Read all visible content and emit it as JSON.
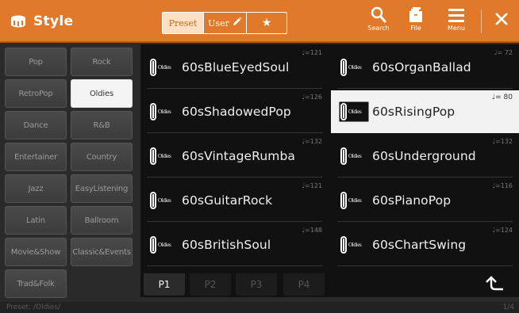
{
  "header": {
    "title": "Style",
    "tabs": {
      "preset": "Preset",
      "user": "User",
      "favorite": "★"
    },
    "buttons": {
      "search": "Search",
      "file": "File",
      "menu": "Menu"
    }
  },
  "categories": [
    "Pop",
    "Rock",
    "RetroPop",
    "Oldies",
    "Dance",
    "R&B",
    "Entertainer",
    "Country",
    "Jazz",
    "EasyListening",
    "Latin",
    "Ballroom",
    "Movie&Show",
    "Classic&Events",
    "Trad&Folk"
  ],
  "selected_category": "Oldies",
  "styles": [
    {
      "name": "60sBlueEyedSoul",
      "tempo": "♩=121"
    },
    {
      "name": "60sOrganBallad",
      "tempo": "♩= 72"
    },
    {
      "name": "60sShadowedPop",
      "tempo": "♩=126"
    },
    {
      "name": "60sRisingPop",
      "tempo": "♩= 80"
    },
    {
      "name": "60sVintageRumba",
      "tempo": "♩=132"
    },
    {
      "name": "60sUnderground",
      "tempo": "♩=132"
    },
    {
      "name": "60sGuitarRock",
      "tempo": "♩=121"
    },
    {
      "name": "60sPianoPop",
      "tempo": "♩=116"
    },
    {
      "name": "60sBritishSoul",
      "tempo": "♩=148"
    },
    {
      "name": "60sChartSwing",
      "tempo": "♩=124"
    }
  ],
  "selected_style": "60sRisingPop",
  "style_icon_text": "Oldies",
  "page_tabs": [
    "P1",
    "P2",
    "P3",
    "P4"
  ],
  "active_page": "P1",
  "status": {
    "path": "Preset: /Oldies/",
    "page_indicator": "1/4"
  },
  "colors": {
    "accent": "#e07a2a",
    "accent_dark": "#b8591a",
    "selected_bg": "#f2f2f2"
  }
}
